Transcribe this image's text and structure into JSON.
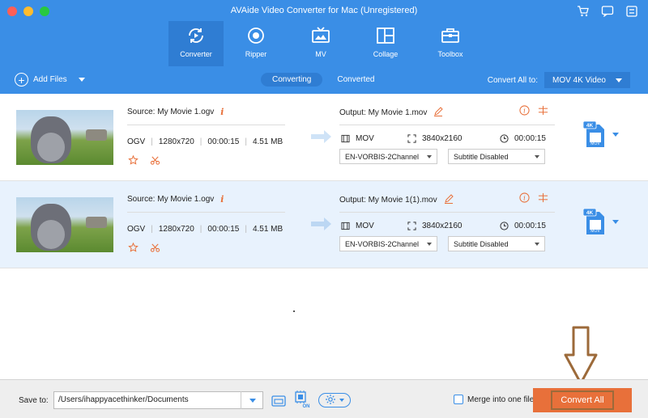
{
  "window": {
    "title": "AVAide Video Converter for Mac (Unregistered)"
  },
  "nav": [
    {
      "label": "Converter",
      "icon": "converter-icon",
      "active": true
    },
    {
      "label": "Ripper",
      "icon": "ripper-icon"
    },
    {
      "label": "MV",
      "icon": "mv-icon"
    },
    {
      "label": "Collage",
      "icon": "collage-icon"
    },
    {
      "label": "Toolbox",
      "icon": "toolbox-icon"
    }
  ],
  "toolbar": {
    "add_files": "Add Files",
    "tabs": [
      "Converting",
      "Converted"
    ],
    "convert_all_to_label": "Convert All to:",
    "convert_all_to_value": "MOV 4K Video"
  },
  "files": [
    {
      "source": "Source: My Movie 1.ogv",
      "format": "OGV",
      "resolution": "1280x720",
      "duration": "00:00:15",
      "size": "4.51 MB",
      "output": "Output: My Movie 1.mov",
      "out_format": "MOV",
      "out_resolution": "3840x2160",
      "out_duration": "00:00:15",
      "audio": "EN-VORBIS-2Channel",
      "subtitle": "Subtitle Disabled",
      "badge_top": "4K",
      "badge_bottom": "MOV"
    },
    {
      "source": "Source: My Movie 1.ogv",
      "format": "OGV",
      "resolution": "1280x720",
      "duration": "00:00:15",
      "size": "4.51 MB",
      "output": "Output: My Movie 1(1).mov",
      "out_format": "MOV",
      "out_resolution": "3840x2160",
      "out_duration": "00:00:15",
      "audio": "EN-VORBIS-2Channel",
      "subtitle": "Subtitle Disabled",
      "badge_top": "4K",
      "badge_bottom": "MOV"
    }
  ],
  "footer": {
    "save_to_label": "Save to:",
    "save_path": "/Users/ihappyacethinker/Documents",
    "gpu_badge": "ON",
    "merge_label": "Merge into one file",
    "convert_all": "Convert All"
  },
  "colors": {
    "primary": "#3a8ee6",
    "accent": "#e8703a",
    "row_highlight": "#e8f2fd"
  }
}
